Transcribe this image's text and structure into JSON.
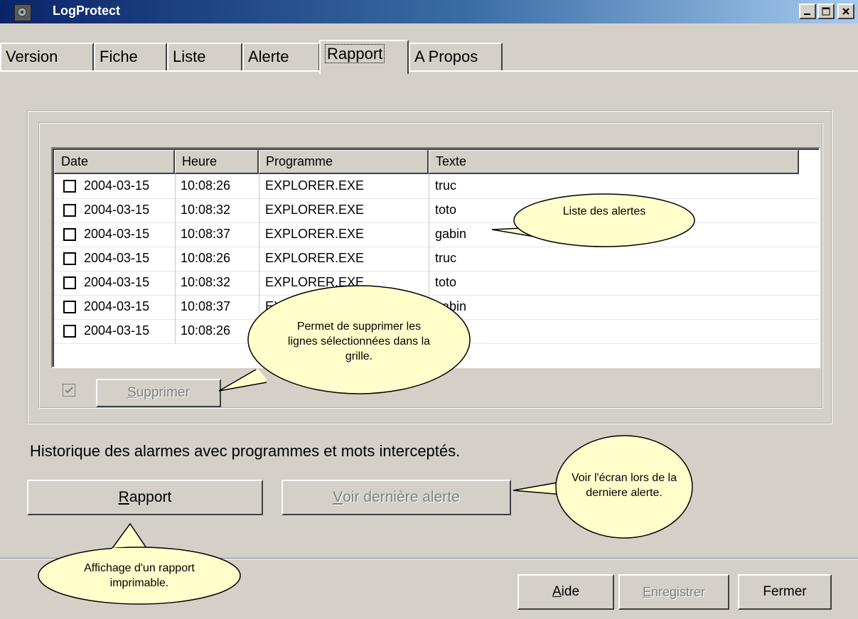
{
  "window": {
    "title": "LogProtect"
  },
  "tabs": [
    "Version",
    "Fiche",
    "Liste",
    "Alerte",
    "Rapport",
    "A Propos"
  ],
  "active_tab": "Rapport",
  "list": {
    "columns": [
      "Date",
      "Heure",
      "Programme",
      "Texte"
    ],
    "rows": [
      {
        "date": "2004-03-15",
        "heure": "10:08:26",
        "programme": "EXPLORER.EXE",
        "texte": "truc"
      },
      {
        "date": "2004-03-15",
        "heure": "10:08:32",
        "programme": "EXPLORER.EXE",
        "texte": "toto"
      },
      {
        "date": "2004-03-15",
        "heure": "10:08:37",
        "programme": "EXPLORER.EXE",
        "texte": "gabin"
      },
      {
        "date": "2004-03-15",
        "heure": "10:08:26",
        "programme": "EXPLORER.EXE",
        "texte": "truc"
      },
      {
        "date": "2004-03-15",
        "heure": "10:08:32",
        "programme": "EXPLORER.EXE",
        "texte": "toto"
      },
      {
        "date": "2004-03-15",
        "heure": "10:08:37",
        "programme": "EXPLORER.EXE",
        "texte": "gabin"
      },
      {
        "date": "2004-03-15",
        "heure": "10:08:26",
        "programme": "",
        "texte": ""
      }
    ]
  },
  "supprimer": {
    "label_pre": "",
    "label_ul": "S",
    "label_post": "upprimer",
    "checkbox_checked": true
  },
  "description": "Historique des alarmes avec programmes et mots interceptés.",
  "buttons": {
    "rapport": {
      "ul": "R",
      "rest": "apport"
    },
    "voir": {
      "ul": "V",
      "rest": "oir dernière alerte"
    },
    "aide": {
      "ul": "A",
      "rest": "ide"
    },
    "enregistrer": {
      "ul": "E",
      "rest": "nregistrer"
    },
    "fermer": "Fermer"
  },
  "callouts": {
    "liste": "Liste des alertes",
    "supprimer": "Permet de supprimer les lignes sélectionnées dans la grille.",
    "voir": "Voir l'écran lors de la derniere alerte.",
    "rapport": "Affichage d'un rapport imprimable."
  },
  "colors": {
    "title_start": "#0a246a",
    "title_end": "#a6caf0",
    "callout_fill": "#ffffcc",
    "face": "#d4d0c8"
  }
}
